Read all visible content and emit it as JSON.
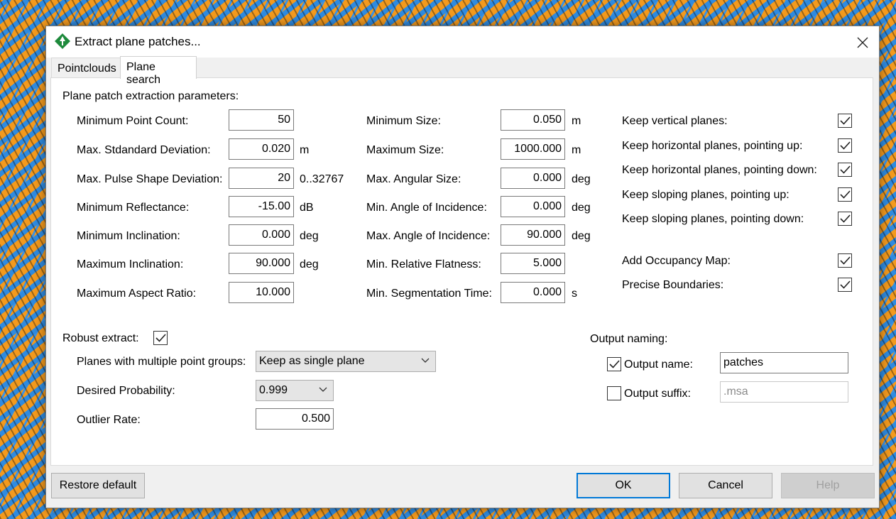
{
  "window": {
    "title": "Extract plane patches..."
  },
  "tabs": [
    {
      "label": "Pointclouds"
    },
    {
      "label": "Plane search"
    }
  ],
  "section_title": "Plane patch extraction parameters:",
  "left_params": [
    {
      "label": "Minimum Point Count:",
      "value": "50",
      "unit": ""
    },
    {
      "label": "Max. Stdandard Deviation:",
      "value": "0.020",
      "unit": "m"
    },
    {
      "label": "Max. Pulse Shape Deviation:",
      "value": "20",
      "unit": "0..32767"
    },
    {
      "label": "Minimum Reflectance:",
      "value": "-15.00",
      "unit": "dB"
    },
    {
      "label": "Minimum Inclination:",
      "value": "0.000",
      "unit": "deg"
    },
    {
      "label": "Maximum Inclination:",
      "value": "90.000",
      "unit": "deg"
    },
    {
      "label": "Maximum Aspect Ratio:",
      "value": "10.000",
      "unit": ""
    }
  ],
  "mid_params": [
    {
      "label": "Minimum Size:",
      "value": "0.050",
      "unit": "m"
    },
    {
      "label": "Maximum Size:",
      "value": "1000.000",
      "unit": "m"
    },
    {
      "label": "Max. Angular Size:",
      "value": "0.000",
      "unit": "deg"
    },
    {
      "label": "Min. Angle of Incidence:",
      "value": "0.000",
      "unit": "deg"
    },
    {
      "label": "Max. Angle of Incidence:",
      "value": "90.000",
      "unit": "deg"
    },
    {
      "label": "Min. Relative Flatness:",
      "value": "5.000",
      "unit": ""
    },
    {
      "label": "Min. Segmentation Time:",
      "value": "0.000",
      "unit": "s"
    }
  ],
  "right_checks": [
    {
      "label": "Keep vertical planes:",
      "checked": true
    },
    {
      "label": "Keep horizontal planes, pointing up:",
      "checked": true
    },
    {
      "label": "Keep horizontal planes, pointing down:",
      "checked": true
    },
    {
      "label": "Keep sloping planes, pointing up:",
      "checked": true
    },
    {
      "label": "Keep sloping planes, pointing down:",
      "checked": true
    },
    {
      "label": "Add Occupancy Map:",
      "checked": true
    },
    {
      "label": "Precise Boundaries:",
      "checked": true
    }
  ],
  "robust": {
    "label": "Robust extract:",
    "checked": true,
    "multi_groups_label": "Planes with multiple point groups:",
    "multi_groups_value": "Keep as single plane",
    "probability_label": "Desired Probability:",
    "probability_value": "0.999",
    "outlier_label": "Outlier Rate:",
    "outlier_value": "0.500"
  },
  "output": {
    "title": "Output naming:",
    "name_label": "Output name:",
    "name_checked": true,
    "name_value": "patches",
    "suffix_label": "Output suffix:",
    "suffix_checked": false,
    "suffix_value": ".msa"
  },
  "buttons": {
    "restore": "Restore default",
    "ok": "OK",
    "cancel": "Cancel",
    "help": "Help"
  },
  "colors": {
    "accent": "#0078d7",
    "icon_green": "#1e8a3c"
  }
}
